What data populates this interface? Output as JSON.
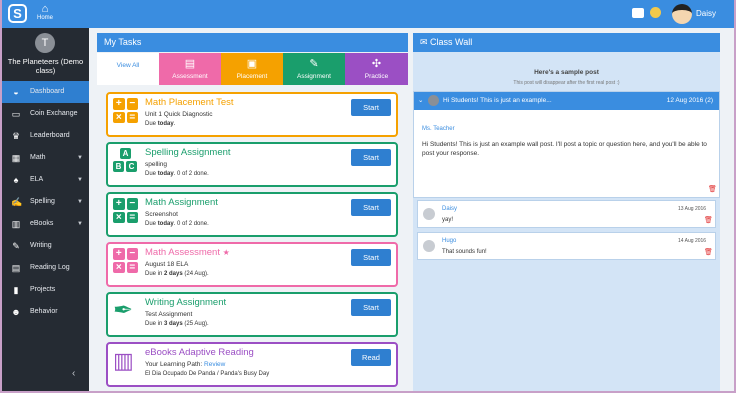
{
  "app": {
    "home_label": "Home",
    "user_name": "Daisy"
  },
  "sidebar": {
    "avatar_letter": "T",
    "class_name": "The Planeteers (Demo class)",
    "items": [
      {
        "label": "Dashboard",
        "icon": "dashboard-icon",
        "glyph": "◒",
        "active": true
      },
      {
        "label": "Coin Exchange",
        "icon": "coin-exchange-icon",
        "glyph": "▭"
      },
      {
        "label": "Leaderboard",
        "icon": "trophy-icon",
        "glyph": "♛"
      },
      {
        "label": "Math",
        "icon": "calculator-icon",
        "glyph": "▦",
        "caret": true
      },
      {
        "label": "ELA",
        "icon": "ela-icon",
        "glyph": "♠",
        "caret": true
      },
      {
        "label": "Spelling",
        "icon": "spelling-icon",
        "glyph": "✍",
        "caret": true
      },
      {
        "label": "eBooks",
        "icon": "ebooks-icon",
        "glyph": "▥",
        "caret": true
      },
      {
        "label": "Writing",
        "icon": "pencil-icon",
        "glyph": "✎"
      },
      {
        "label": "Reading Log",
        "icon": "book-icon",
        "glyph": "▤"
      },
      {
        "label": "Projects",
        "icon": "projects-icon",
        "glyph": "▮"
      },
      {
        "label": "Behavior",
        "icon": "behavior-icon",
        "glyph": "☻"
      }
    ],
    "collapse_glyph": "‹"
  },
  "tasks": {
    "title": "My Tasks",
    "tabs": [
      {
        "label": "View All",
        "color": "#ffffff"
      },
      {
        "label": "Assessment",
        "color": "#ef6aa9",
        "glyph": "▤"
      },
      {
        "label": "Placement",
        "color": "#f5a100",
        "glyph": "▣"
      },
      {
        "label": "Assignment",
        "color": "#1a9e6c",
        "glyph": "✎"
      },
      {
        "label": "Practice",
        "color": "#9b4fc4",
        "glyph": "✣"
      }
    ],
    "cards": [
      {
        "title": "Math Placement Test",
        "line1": "Unit 1 Quick Diagnostic",
        "due_pre": "Due ",
        "due_bold": "today",
        "due_post": ".",
        "button": "Start",
        "color": "#f5a100",
        "icon": "math-ops-icon"
      },
      {
        "title": "Spelling Assignment",
        "line1": "spelling",
        "due_pre": "Due ",
        "due_bold": "today",
        "due_post": ". 0 of 2 done.",
        "button": "Start",
        "color": "#1a9e6c",
        "icon": "abc-blocks-icon"
      },
      {
        "title": "Math Assignment",
        "line1": "Screenshot",
        "due_pre": "Due ",
        "due_bold": "today",
        "due_post": ". 0 of 2 done.",
        "button": "Start",
        "color": "#1a9e6c",
        "icon": "math-ops-icon"
      },
      {
        "title": "Math Assessment",
        "star": "★",
        "line1": "August 18 ELA",
        "due_pre": "Due in ",
        "due_bold": "2 days",
        "due_post": " (24 Aug).",
        "button": "Start",
        "color": "#ef6aa9",
        "icon": "math-ops-icon"
      },
      {
        "title": "Writing Assignment",
        "line1": "Test Assignment",
        "due_pre": "Due in ",
        "due_bold": "3 days",
        "due_post": " (25 Aug).",
        "button": "Start",
        "color": "#1a9e6c",
        "icon": "writing-pen-icon"
      },
      {
        "title": "eBooks Adaptive Reading",
        "line1_pre": "Your Learning Path: ",
        "line1_link": "Review",
        "line2": "El Dia Ocupado De Panda / Panda's Busy Day",
        "button": "Read",
        "color": "#9b4fc4",
        "icon": "books-icon"
      }
    ]
  },
  "wall": {
    "title": "Class Wall",
    "sample_title": "Here's a sample post",
    "sample_sub": "This post will disappear after the first real post :)",
    "post": {
      "title": "Hi Students! This is just an example...",
      "date": "12 Aug 2016 (2)",
      "author": "Ms. Teacher",
      "body": "Hi Students! This is just an example wall post. I'll post a topic or question here, and you'll be able to post your response."
    },
    "replies": [
      {
        "name": "Daisy",
        "text": "yay!",
        "date": "13 Aug 2016"
      },
      {
        "name": "Hugo",
        "text": "That sounds fun!",
        "date": "14 Aug 2016"
      }
    ]
  },
  "colors": {
    "brand": "#3a8de0",
    "sidebar": "#252b33"
  }
}
